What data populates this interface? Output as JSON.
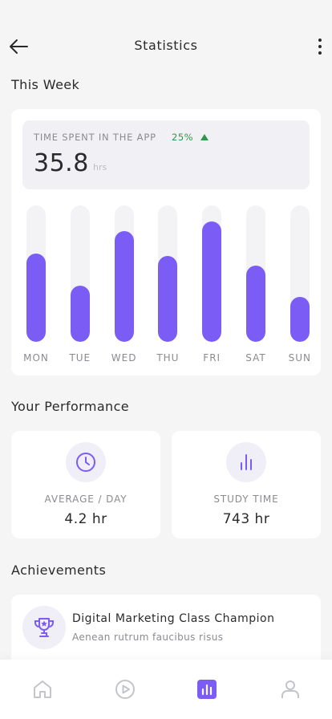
{
  "header": {
    "title": "Statistics"
  },
  "sections": {
    "this_week": "This Week",
    "performance": "Your Performance",
    "achievements": "Achievements"
  },
  "time_spent": {
    "label": "TIME SPENT IN THE APP",
    "change": "25%",
    "value": "35.8",
    "unit": "hrs"
  },
  "chart_data": {
    "type": "bar",
    "categories": [
      "MON",
      "TUE",
      "WED",
      "THU",
      "FRI",
      "SAT",
      "SUN"
    ],
    "values": [
      0.65,
      0.41,
      0.81,
      0.63,
      0.88,
      0.56,
      0.33
    ],
    "ylim": [
      0,
      1
    ],
    "grid": false
  },
  "performance": [
    {
      "label": "AVERAGE / DAY",
      "value": "4.2 hr",
      "icon": "clock-icon"
    },
    {
      "label": "STUDY TIME",
      "value": "743 hr",
      "icon": "bar-chart-icon"
    }
  ],
  "achievement": {
    "title": "Digital Marketing Class Champion",
    "subtitle": "Aenean rutrum faucibus risus",
    "icon": "trophy-icon"
  },
  "tabs": [
    {
      "icon": "home-icon",
      "active": false
    },
    {
      "icon": "play-icon",
      "active": false
    },
    {
      "icon": "statistics-icon",
      "active": true
    },
    {
      "icon": "profile-icon",
      "active": false
    }
  ],
  "colors": {
    "accent": "#7b5cf5",
    "positive": "#2a9a4a",
    "inactive_icon": "#c4c4cc"
  }
}
